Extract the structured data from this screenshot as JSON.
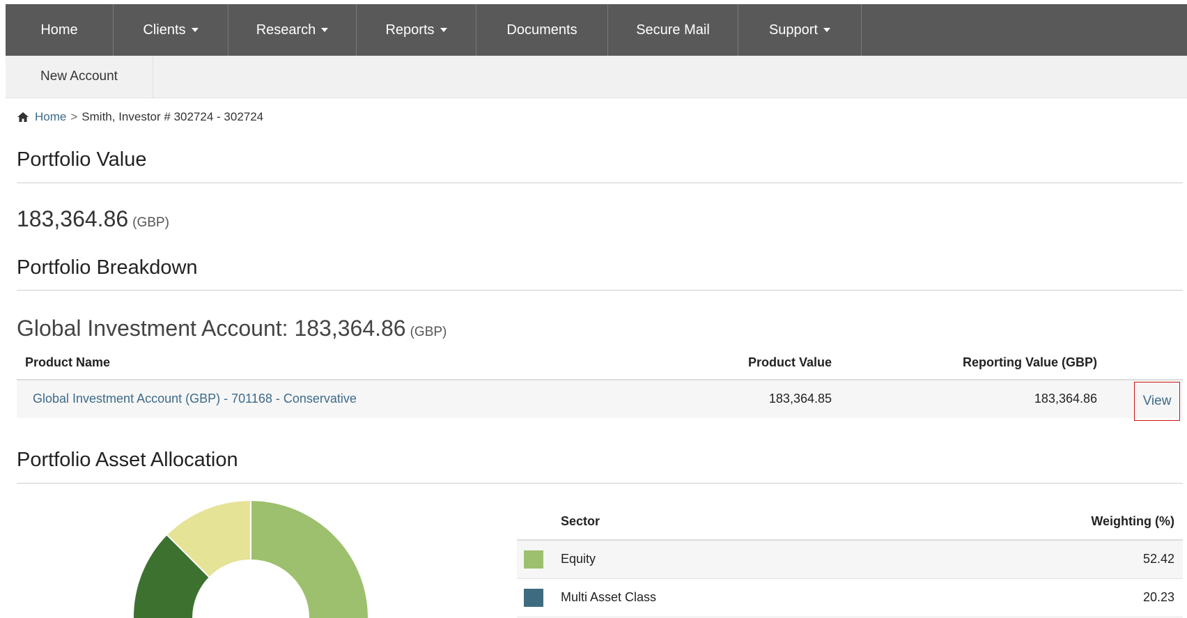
{
  "nav": {
    "items": [
      {
        "label": "Home",
        "dropdown": false
      },
      {
        "label": "Clients",
        "dropdown": true
      },
      {
        "label": "Research",
        "dropdown": true
      },
      {
        "label": "Reports",
        "dropdown": true
      },
      {
        "label": "Documents",
        "dropdown": false
      },
      {
        "label": "Secure Mail",
        "dropdown": false
      },
      {
        "label": "Support",
        "dropdown": true
      }
    ],
    "sub_item": "New Account"
  },
  "breadcrumb": {
    "home_label": "Home",
    "separator": ">",
    "current": "Smith, Investor # 302724 - 302724"
  },
  "portfolio_value": {
    "heading": "Portfolio Value",
    "amount": "183,364.86",
    "currency": "(GBP)"
  },
  "portfolio_breakdown": {
    "heading": "Portfolio Breakdown",
    "account_name": "Global Investment Account: 183,364.86",
    "account_currency": "(GBP)",
    "columns": {
      "product_name": "Product Name",
      "product_value": "Product Value",
      "reporting_value": "Reporting Value (GBP)"
    },
    "rows": [
      {
        "product_name": "Global Investment Account (GBP) - 701168 - Conservative",
        "product_value": "183,364.85",
        "reporting_value": "183,364.86",
        "action": "View"
      }
    ]
  },
  "asset_allocation": {
    "heading": "Portfolio Asset Allocation",
    "columns": {
      "sector": "Sector",
      "weighting": "Weighting (%)"
    },
    "rows": [
      {
        "sector": "Equity",
        "weighting": "52.42",
        "color": "#9dc06e"
      },
      {
        "sector": "Multi Asset Class",
        "weighting": "20.23",
        "color": "#3f6b80"
      }
    ]
  },
  "colors": {
    "nav_bg": "#595959",
    "link": "#3d6a8a",
    "highlight_border": "#d01515",
    "donut_dark_green": "#3c7130",
    "donut_pale_yellow": "#e5e396",
    "donut_light_green": "#9dc06e"
  }
}
